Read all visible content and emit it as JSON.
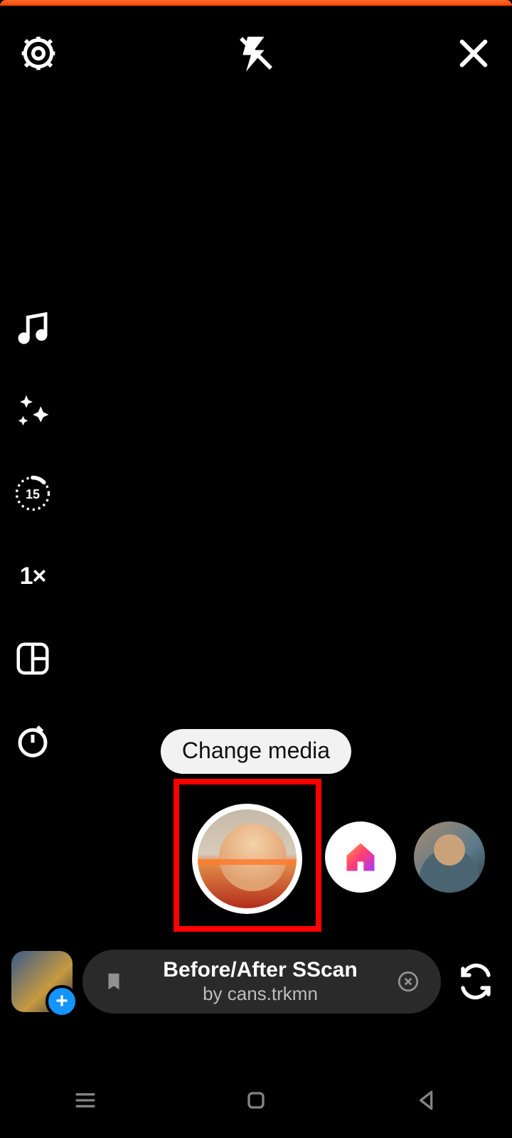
{
  "top": {
    "settings_icon": "settings",
    "flash_icon": "flash-off",
    "close_icon": "close"
  },
  "side": {
    "music_icon": "music",
    "effects_icon": "sparkles",
    "duration_value": "15",
    "speed_label": "1×",
    "layout_icon": "layout-grid",
    "timer_icon": "timer"
  },
  "change_media_label": "Change media",
  "carousel": {
    "home_icon": "home"
  },
  "gallery": {
    "add_icon": "plus"
  },
  "filter": {
    "title": "Before/After SScan",
    "by_prefix": "by ",
    "author": "cans.trkmn",
    "bookmark_icon": "bookmark",
    "dismiss_icon": "close-circle"
  },
  "flip_icon": "camera-flip",
  "nav": {
    "recents": "recents",
    "home": "home",
    "back": "back"
  }
}
